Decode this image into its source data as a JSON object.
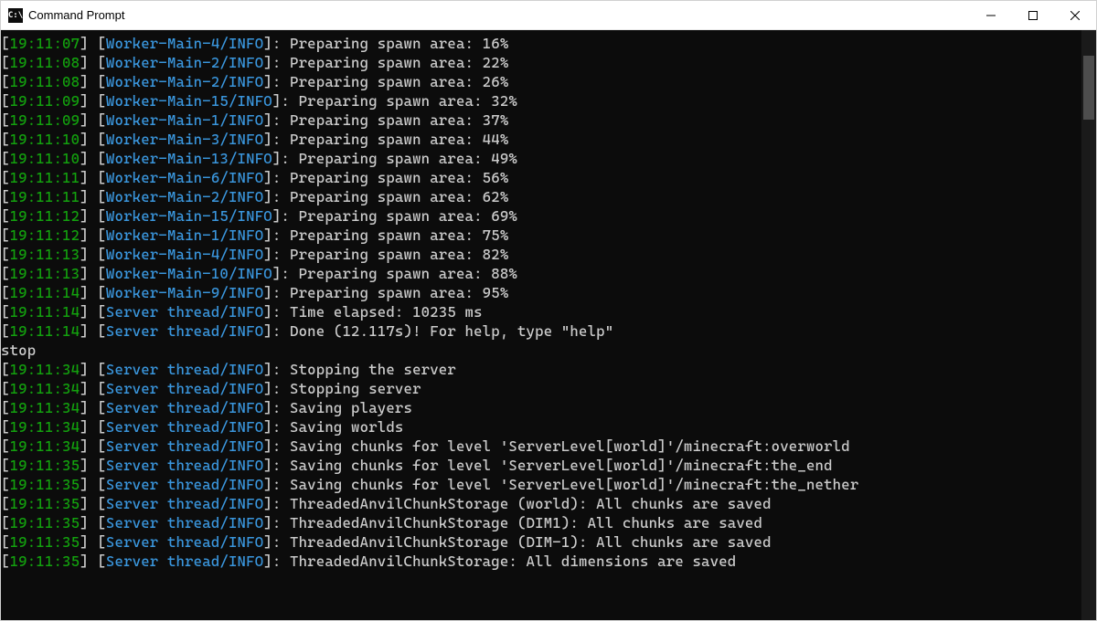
{
  "window": {
    "title": "Command Prompt",
    "icon_text": "C:\\"
  },
  "colors": {
    "timestamp": "#13a10e",
    "source": "#3a96dd",
    "message": "#cccccc",
    "input": "#cccccc",
    "bg": "#0c0c0c"
  },
  "log_lines": [
    {
      "type": "log",
      "time": "19:11:07",
      "src": "Worker-Main-4/INFO",
      "msg": "Preparing spawn area: 16%"
    },
    {
      "type": "log",
      "time": "19:11:08",
      "src": "Worker-Main-2/INFO",
      "msg": "Preparing spawn area: 22%"
    },
    {
      "type": "log",
      "time": "19:11:08",
      "src": "Worker-Main-2/INFO",
      "msg": "Preparing spawn area: 26%"
    },
    {
      "type": "log",
      "time": "19:11:09",
      "src": "Worker-Main-15/INFO",
      "msg": "Preparing spawn area: 32%"
    },
    {
      "type": "log",
      "time": "19:11:09",
      "src": "Worker-Main-1/INFO",
      "msg": "Preparing spawn area: 37%"
    },
    {
      "type": "log",
      "time": "19:11:10",
      "src": "Worker-Main-3/INFO",
      "msg": "Preparing spawn area: 44%"
    },
    {
      "type": "log",
      "time": "19:11:10",
      "src": "Worker-Main-13/INFO",
      "msg": "Preparing spawn area: 49%"
    },
    {
      "type": "log",
      "time": "19:11:11",
      "src": "Worker-Main-6/INFO",
      "msg": "Preparing spawn area: 56%"
    },
    {
      "type": "log",
      "time": "19:11:11",
      "src": "Worker-Main-2/INFO",
      "msg": "Preparing spawn area: 62%"
    },
    {
      "type": "log",
      "time": "19:11:12",
      "src": "Worker-Main-15/INFO",
      "msg": "Preparing spawn area: 69%"
    },
    {
      "type": "log",
      "time": "19:11:12",
      "src": "Worker-Main-1/INFO",
      "msg": "Preparing spawn area: 75%"
    },
    {
      "type": "log",
      "time": "19:11:13",
      "src": "Worker-Main-4/INFO",
      "msg": "Preparing spawn area: 82%"
    },
    {
      "type": "log",
      "time": "19:11:13",
      "src": "Worker-Main-10/INFO",
      "msg": "Preparing spawn area: 88%"
    },
    {
      "type": "log",
      "time": "19:11:14",
      "src": "Worker-Main-9/INFO",
      "msg": "Preparing spawn area: 95%"
    },
    {
      "type": "log",
      "time": "19:11:14",
      "src": "Server thread/INFO",
      "msg": "Time elapsed: 10235 ms"
    },
    {
      "type": "log",
      "time": "19:11:14",
      "src": "Server thread/INFO",
      "msg": "Done (12.117s)! For help, type \"help\""
    },
    {
      "type": "input",
      "text": "stop"
    },
    {
      "type": "log",
      "time": "19:11:34",
      "src": "Server thread/INFO",
      "msg": "Stopping the server"
    },
    {
      "type": "log",
      "time": "19:11:34",
      "src": "Server thread/INFO",
      "msg": "Stopping server"
    },
    {
      "type": "log",
      "time": "19:11:34",
      "src": "Server thread/INFO",
      "msg": "Saving players"
    },
    {
      "type": "log",
      "time": "19:11:34",
      "src": "Server thread/INFO",
      "msg": "Saving worlds"
    },
    {
      "type": "log",
      "time": "19:11:34",
      "src": "Server thread/INFO",
      "msg": "Saving chunks for level 'ServerLevel[world]'/minecraft:overworld"
    },
    {
      "type": "log",
      "time": "19:11:35",
      "src": "Server thread/INFO",
      "msg": "Saving chunks for level 'ServerLevel[world]'/minecraft:the_end"
    },
    {
      "type": "log",
      "time": "19:11:35",
      "src": "Server thread/INFO",
      "msg": "Saving chunks for level 'ServerLevel[world]'/minecraft:the_nether"
    },
    {
      "type": "log",
      "time": "19:11:35",
      "src": "Server thread/INFO",
      "msg": "ThreadedAnvilChunkStorage (world): All chunks are saved"
    },
    {
      "type": "log",
      "time": "19:11:35",
      "src": "Server thread/INFO",
      "msg": "ThreadedAnvilChunkStorage (DIM1): All chunks are saved"
    },
    {
      "type": "log",
      "time": "19:11:35",
      "src": "Server thread/INFO",
      "msg": "ThreadedAnvilChunkStorage (DIM-1): All chunks are saved"
    },
    {
      "type": "log",
      "time": "19:11:35",
      "src": "Server thread/INFO",
      "msg": "ThreadedAnvilChunkStorage: All dimensions are saved"
    }
  ]
}
